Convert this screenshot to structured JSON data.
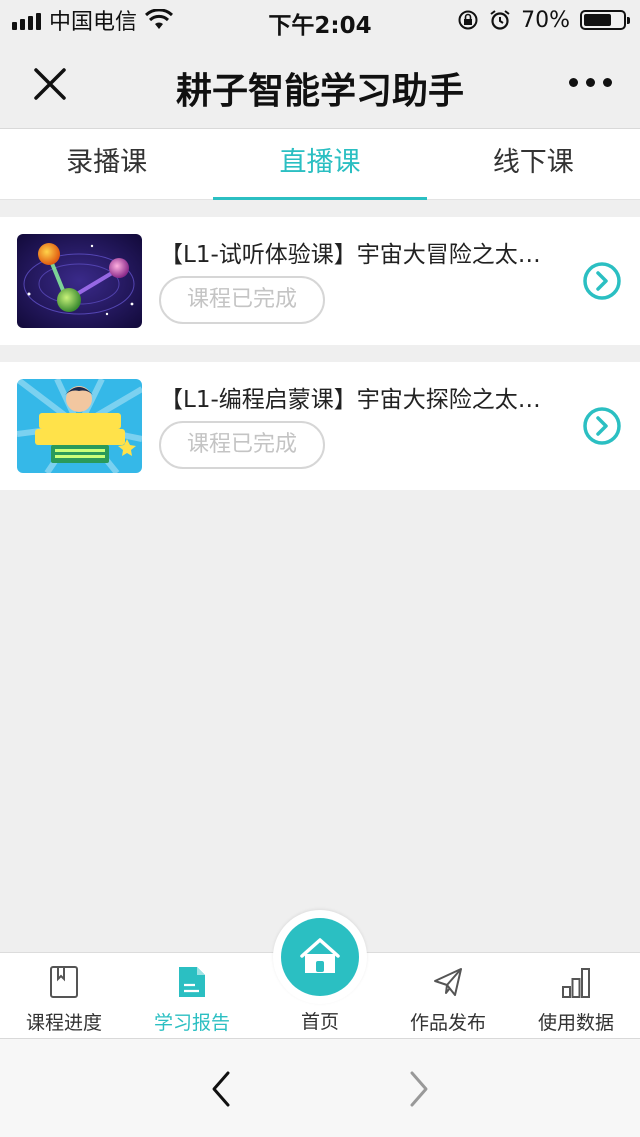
{
  "status_bar": {
    "carrier": "中国电信",
    "time": "下午2:04",
    "battery_percent": "70%",
    "battery_level": 0.7,
    "icons": [
      "signal-icon",
      "wifi-icon",
      "orientation-lock-icon",
      "alarm-icon",
      "battery-icon"
    ]
  },
  "nav": {
    "title": "耕子智能学习助手",
    "close_icon": "close-icon",
    "more_icon": "more-icon"
  },
  "tabs": [
    {
      "label": "录播课",
      "active": false
    },
    {
      "label": "直播课",
      "active": true
    },
    {
      "label": "线下课",
      "active": false
    }
  ],
  "courses": [
    {
      "title": "【L1-试听体验课】宇宙大冒险之太…",
      "status": "课程已完成",
      "thumb": "space-planets-thumbnail"
    },
    {
      "title": "【L1-编程启蒙课】宇宙大探险之太…",
      "status": "课程已完成",
      "thumb": "kids-coding-poster-thumbnail"
    }
  ],
  "bottom_tabs": [
    {
      "label": "课程进度",
      "icon": "book-icon",
      "active": false
    },
    {
      "label": "学习报告",
      "icon": "report-icon",
      "active": true
    },
    {
      "label": "首页",
      "icon": "home-icon",
      "active": false
    },
    {
      "label": "作品发布",
      "icon": "paper-plane-icon",
      "active": false
    },
    {
      "label": "使用数据",
      "icon": "bar-chart-icon",
      "active": false
    }
  ],
  "colors": {
    "accent": "#2bbfc2",
    "background": "#efefef",
    "badge_border": "#d6d6d6",
    "badge_text": "#c4c4c4"
  }
}
